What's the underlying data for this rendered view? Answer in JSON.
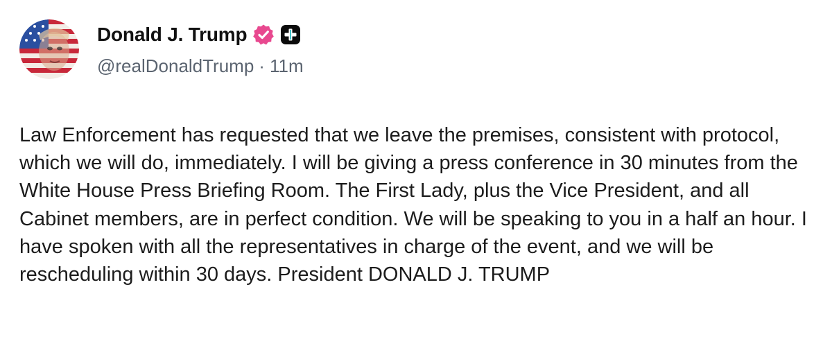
{
  "author": {
    "display_name": "Donald J. Trump",
    "handle": "@realDonaldTrump",
    "separator": "·",
    "timestamp": "11m",
    "avatar_icon": "avatar-flag-portrait-icon",
    "verified_icon": "verified-badge-icon",
    "plus_icon": "plus-badge-icon"
  },
  "colors": {
    "verified_badge": "#e8488f",
    "plus_badge": "#0b0b0b",
    "meta_text": "#5b6470",
    "body_text": "#1c1c1c"
  },
  "post": {
    "text": "Law Enforcement has requested that we leave the premises, consistent with protocol, which we will do, immediately. I will be giving a press conference in 30 minutes from the White House Press Briefing Room. The First Lady, plus the Vice President, and all Cabinet members, are in perfect condition. We will be speaking to you in a half an hour. I have spoken with all the representatives in charge of the event, and we will be rescheduling within 30 days. President DONALD J. TRUMP"
  }
}
